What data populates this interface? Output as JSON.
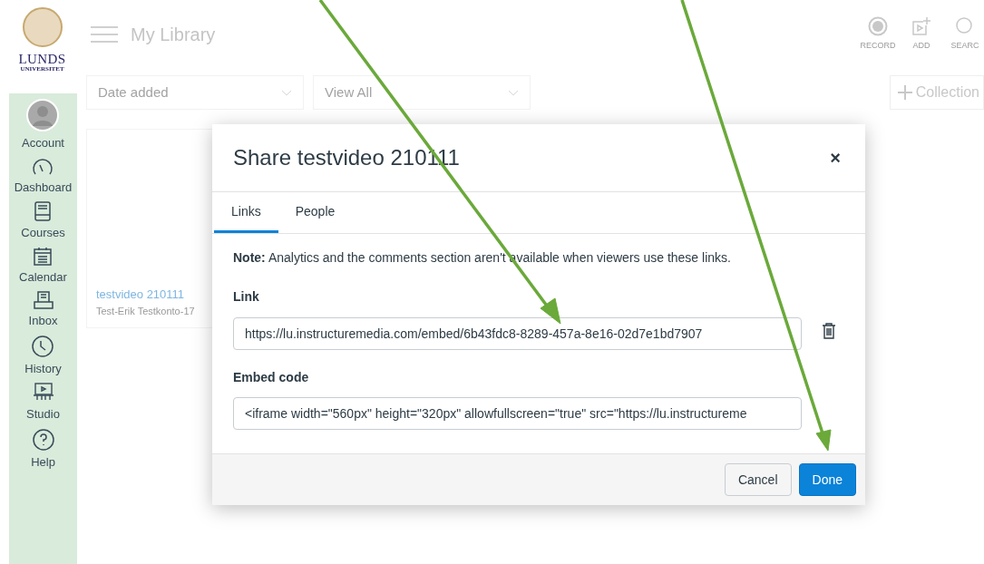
{
  "logo": {
    "line1": "LUNDS",
    "line2": "UNIVERSITET"
  },
  "sidebar": {
    "items": [
      {
        "kind": "account",
        "label": "Account"
      },
      {
        "kind": "dashboard",
        "label": "Dashboard"
      },
      {
        "kind": "courses",
        "label": "Courses"
      },
      {
        "kind": "calendar",
        "label": "Calendar"
      },
      {
        "kind": "inbox",
        "label": "Inbox"
      },
      {
        "kind": "history",
        "label": "History"
      },
      {
        "kind": "studio",
        "label": "Studio"
      },
      {
        "kind": "help",
        "label": "Help"
      }
    ]
  },
  "header": {
    "title": "My Library",
    "actions": [
      {
        "kind": "record",
        "label": "RECORD"
      },
      {
        "kind": "add",
        "label": "ADD"
      },
      {
        "kind": "search",
        "label": "SEARC"
      }
    ]
  },
  "filters": {
    "sort": "Date added",
    "view": "View All",
    "collection_button": "Collection"
  },
  "video_card": {
    "title": "testvideo 210111",
    "owner": "Test-Erik Testkonto-17"
  },
  "dialog": {
    "title": "Share testvideo 210111",
    "close": "×",
    "tabs": [
      {
        "label": "Links",
        "selected": true
      },
      {
        "label": "People",
        "selected": false
      }
    ],
    "note": "**Note:** Analytics and the comments section aren't available when viewers use these links.",
    "link_label": "Link",
    "link_value": "https://lu.instructuremedia.com/embed/6b43fdc8-8289-457a-8e16-02d7e1bd7907",
    "embed_label": "Embed code",
    "embed_value": "<iframe width=\"560px\" height=\"320px\" allowfullscreen=\"true\" src=\"https://lu.instructureme",
    "buttons": [
      {
        "kind": "secondary",
        "label": "Cancel"
      },
      {
        "kind": "primary",
        "label": "Done"
      }
    ]
  }
}
